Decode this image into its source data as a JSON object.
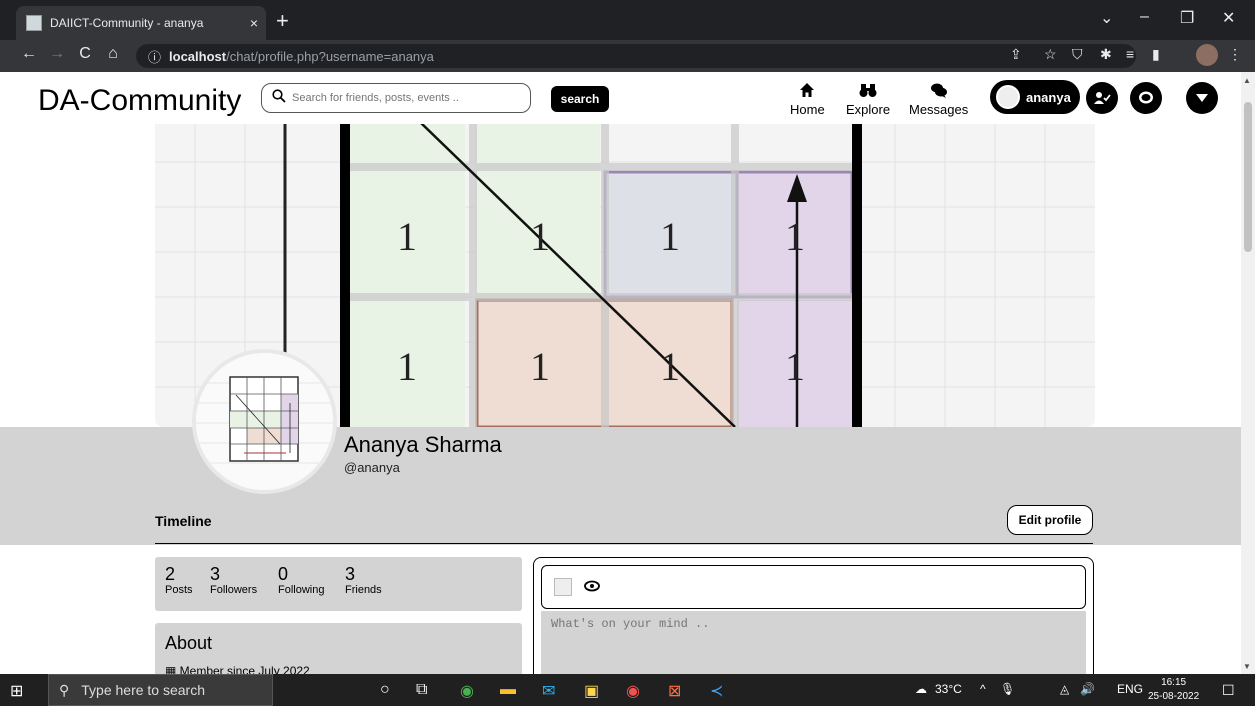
{
  "browser": {
    "tab_title": "DAIICT-Community - ananya",
    "tab_close": "×",
    "new_tab": "+",
    "url_host": "localhost",
    "url_path": "/chat/profile.php?username=ananya",
    "window_controls": [
      "⌄",
      "–",
      "❐",
      "✕"
    ]
  },
  "header": {
    "logo": "DA-Community",
    "search_placeholder": "Search for friends, posts, events ..",
    "search_button": "search",
    "nav": [
      {
        "label": "Home",
        "icon": "home-icon"
      },
      {
        "label": "Explore",
        "icon": "binoculars-icon"
      },
      {
        "label": "Messages",
        "icon": "chat-icon"
      }
    ],
    "username": "ananya"
  },
  "profile": {
    "full_name": "Ananya Sharma",
    "handle": "@ananya",
    "timeline_label": "Timeline",
    "edit_button": "Edit profile",
    "cover_grid": [
      [
        "1",
        "1",
        "1",
        "1"
      ],
      [
        "1",
        "1",
        "1",
        "1"
      ]
    ]
  },
  "stats": [
    {
      "value": "2",
      "label": "Posts"
    },
    {
      "value": "3",
      "label": "Followers"
    },
    {
      "value": "0",
      "label": "Following"
    },
    {
      "value": "3",
      "label": "Friends"
    }
  ],
  "about": {
    "title": "About",
    "member_since": "Member since July 2022"
  },
  "composer": {
    "placeholder": "What's on your mind .."
  },
  "taskbar": {
    "search_placeholder": "Type here to search",
    "temperature": "33°C",
    "language": "ENG",
    "time": "16:15",
    "date": "25-08-2022"
  }
}
